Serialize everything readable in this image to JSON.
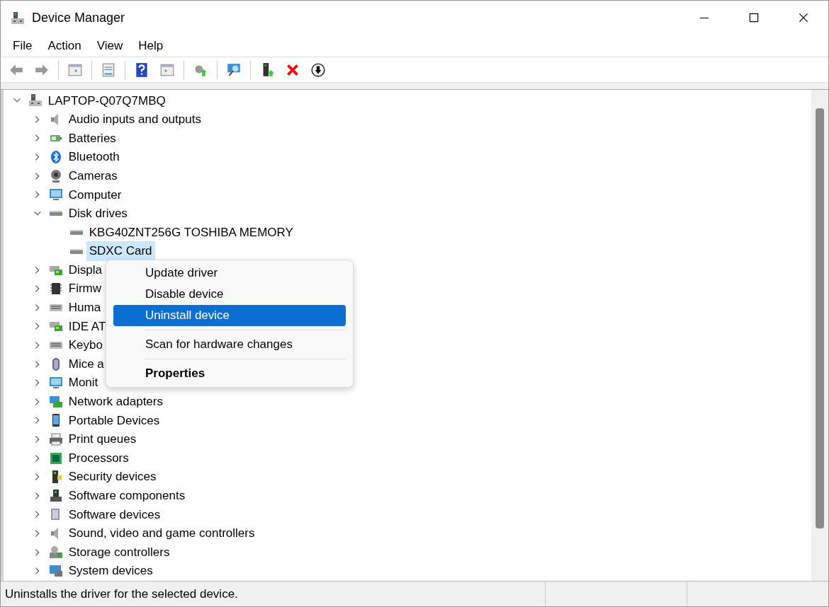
{
  "window": {
    "title": "Device Manager"
  },
  "menu_bar": [
    "File",
    "Action",
    "View",
    "Help"
  ],
  "tree": {
    "label": "LAPTOP-Q07Q7MBQ",
    "expanded": true,
    "selected": false,
    "children": [
      {
        "label": "Audio inputs and outputs",
        "expanded": false,
        "selected": false
      },
      {
        "label": "Batteries",
        "expanded": false,
        "selected": false
      },
      {
        "label": "Bluetooth",
        "expanded": false,
        "selected": false
      },
      {
        "label": "Cameras",
        "expanded": false,
        "selected": false
      },
      {
        "label": "Computer",
        "expanded": false,
        "selected": false
      },
      {
        "label": "Disk drives",
        "expanded": true,
        "selected": false,
        "children": [
          {
            "label": "KBG40ZNT256G TOSHIBA MEMORY",
            "selected": false
          },
          {
            "label": "SDXC Card",
            "selected": true
          }
        ]
      },
      {
        "label": "Displa",
        "expanded": false,
        "selected": false
      },
      {
        "label": "Firmw",
        "expanded": false,
        "selected": false
      },
      {
        "label": "Huma",
        "expanded": false,
        "selected": false
      },
      {
        "label": "IDE AT",
        "expanded": false,
        "selected": false
      },
      {
        "label": "Keybo",
        "expanded": false,
        "selected": false
      },
      {
        "label": "Mice a",
        "expanded": false,
        "selected": false
      },
      {
        "label": "Monit",
        "expanded": false,
        "selected": false
      },
      {
        "label": "Network adapters",
        "expanded": false,
        "selected": false
      },
      {
        "label": "Portable Devices",
        "expanded": false,
        "selected": false
      },
      {
        "label": "Print queues",
        "expanded": false,
        "selected": false
      },
      {
        "label": "Processors",
        "expanded": false,
        "selected": false
      },
      {
        "label": "Security devices",
        "expanded": false,
        "selected": false
      },
      {
        "label": "Software components",
        "expanded": false,
        "selected": false
      },
      {
        "label": "Software devices",
        "expanded": false,
        "selected": false
      },
      {
        "label": "Sound, video and game controllers",
        "expanded": false,
        "selected": false
      },
      {
        "label": "Storage controllers",
        "expanded": false,
        "selected": false
      },
      {
        "label": "System devices",
        "expanded": false,
        "selected": false
      }
    ]
  },
  "context_menu": [
    {
      "kind": "item",
      "label": "Update driver",
      "selected": false,
      "default": false
    },
    {
      "kind": "item",
      "label": "Disable device",
      "selected": false,
      "default": false
    },
    {
      "kind": "item",
      "label": "Uninstall device",
      "selected": true,
      "default": false
    },
    {
      "kind": "separator"
    },
    {
      "kind": "item",
      "label": "Scan for hardware changes",
      "selected": false,
      "default": false
    },
    {
      "kind": "separator"
    },
    {
      "kind": "item",
      "label": "Properties",
      "selected": false,
      "default": true
    }
  ],
  "status_bar": "Uninstalls the driver for the selected device."
}
